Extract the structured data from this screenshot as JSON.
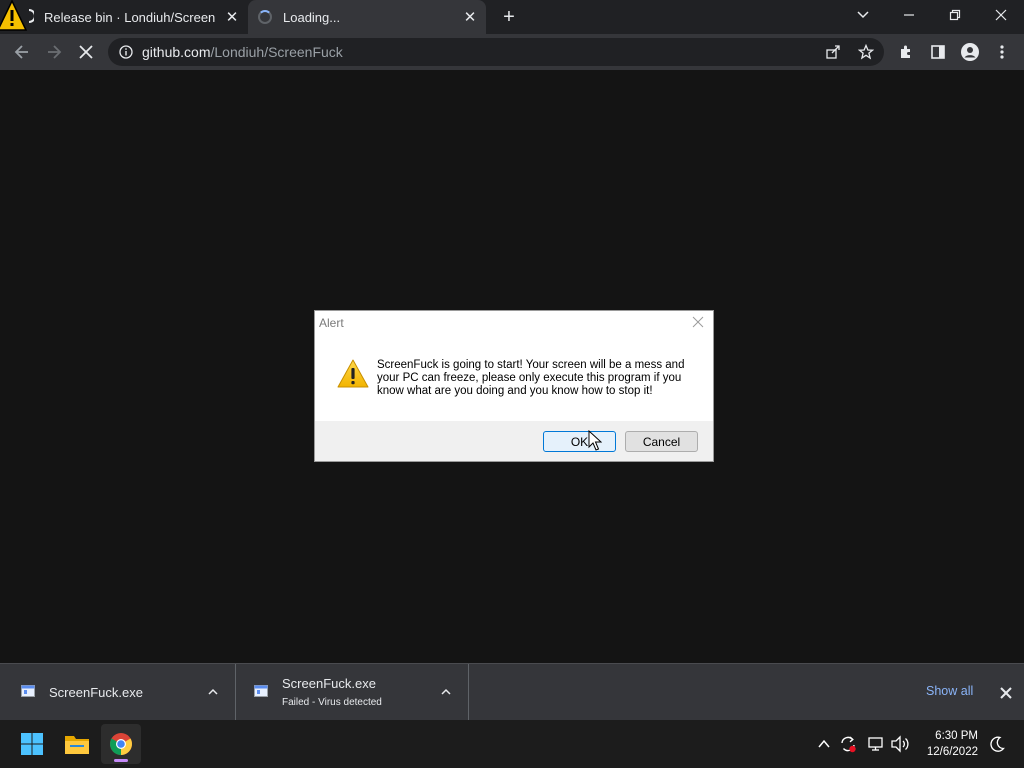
{
  "browser": {
    "tabs": [
      {
        "title": "Release bin · Londiuh/ScreenFuck",
        "icon": "warning-icon"
      },
      {
        "title": "Loading...",
        "icon": "loading-spinner-icon"
      }
    ],
    "address": {
      "host": "github.com",
      "path": "/Londiuh/ScreenFuck"
    }
  },
  "dialog": {
    "title": "Alert",
    "message": "ScreenFuck is going to start! Your screen will be a mess and your PC can freeze, please only execute this program if you know what are you doing and you know how to stop it!",
    "ok_label": "OK",
    "cancel_label": "Cancel"
  },
  "downloads": {
    "items": [
      {
        "name": "ScreenFuck.exe",
        "status": ""
      },
      {
        "name": "ScreenFuck.exe",
        "status": "Failed - Virus detected"
      }
    ],
    "show_all_label": "Show all"
  },
  "taskbar": {
    "time": "6:30 PM",
    "date": "12/6/2022"
  },
  "colors": {
    "accent": "#8ab4f8",
    "page_bg": "#141414",
    "warning": "#f5c000"
  }
}
